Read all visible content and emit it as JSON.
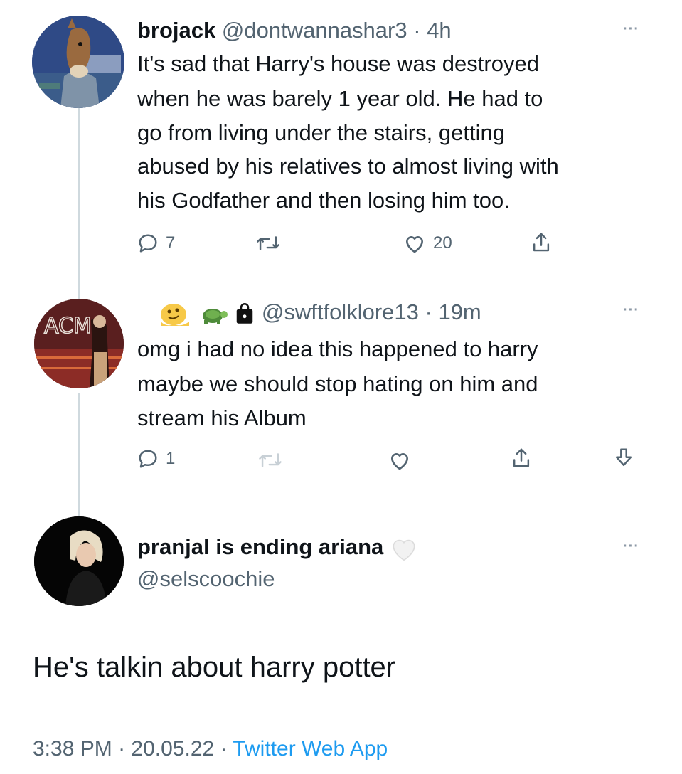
{
  "tweets": [
    {
      "display_name": "brojack",
      "handle": "@dontwannashar3",
      "separator": "·",
      "time": "4h",
      "lines": [
        "It's sad that Harry's house was destroyed",
        "when he was barely 1 year old. He had to",
        "go from living under the stairs, getting",
        "abused by his relatives to almost living with",
        "his Godfather and then losing him too."
      ],
      "reply_count": "7",
      "like_count": "20",
      "more": "···"
    },
    {
      "handle": "@swftfolklore13",
      "separator": "·",
      "time": "19m",
      "lines": [
        "omg i had no idea this happened to harry",
        "maybe we should stop hating on him and",
        "stream his Album"
      ],
      "reply_count": "1",
      "more": "···"
    }
  ],
  "main_tweet": {
    "display_name": "pranjal is ending ariana",
    "handle": "@selscoochie",
    "text": "He's talkin about harry potter",
    "time": "3:38 PM",
    "separator": "·",
    "date": "20.05.22",
    "source_separator": "·",
    "source": "Twitter Web App",
    "more": "···"
  },
  "icons": [
    "reply-icon",
    "retweet-icon",
    "like-icon",
    "share-icon",
    "download-icon",
    "more-icon",
    "shopping-bag-icon",
    "white-heart-icon"
  ],
  "colors": {
    "text": "#0f1419",
    "muted": "#536471",
    "link": "#1d9bf0",
    "thread_line": "#cfd9de"
  }
}
